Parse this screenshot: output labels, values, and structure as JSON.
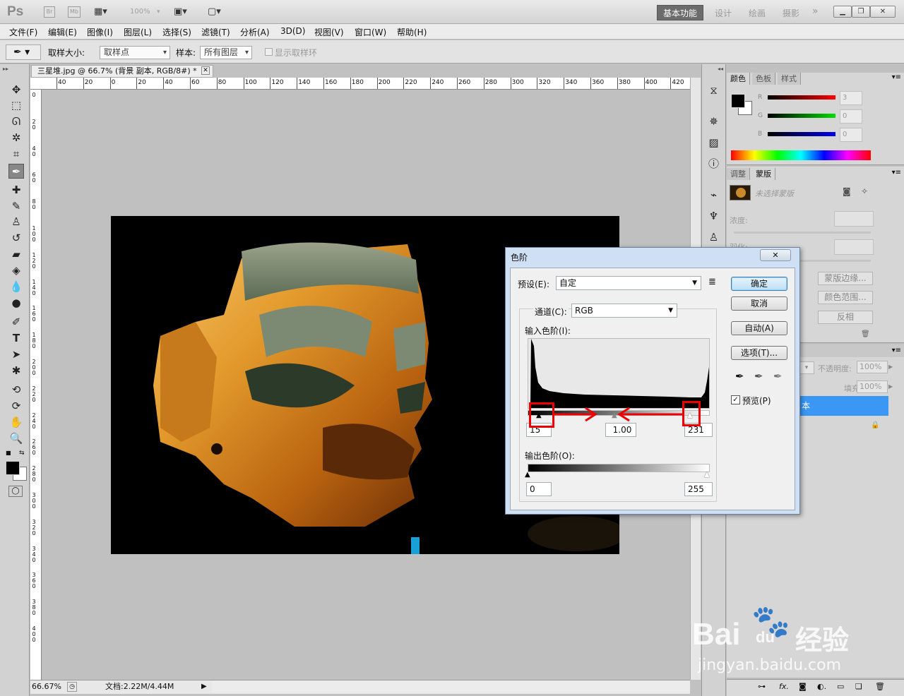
{
  "app": {
    "logo": "Ps",
    "bridge": "Br",
    "minibridge": "Mb",
    "zoom": "100%",
    "workspaces": {
      "active": "基本功能",
      "items": [
        "设计",
        "绘画",
        "摄影"
      ],
      "more": "»"
    }
  },
  "menu": [
    "文件(F)",
    "编辑(E)",
    "图像(I)",
    "图层(L)",
    "选择(S)",
    "滤镜(T)",
    "分析(A)",
    "3D(D)",
    "视图(V)",
    "窗口(W)",
    "帮助(H)"
  ],
  "options": {
    "sample_size_label": "取样大小:",
    "sample_size_value": "取样点",
    "sample_label": "样本:",
    "sample_value": "所有图层",
    "show_ring": "显示取样环"
  },
  "document": {
    "tab_title": "三星堆.jpg @ 66.7% (背景 副本, RGB/8#) *",
    "ruler_top": [
      "40",
      "20",
      "0",
      "20",
      "40",
      "60",
      "80",
      "100",
      "120",
      "140",
      "160",
      "180",
      "200",
      "220",
      "240",
      "260",
      "280",
      "300",
      "320",
      "340",
      "360",
      "380",
      "400",
      "420"
    ],
    "ruler_left": [
      "0",
      "2 0",
      "4 0",
      "6 0",
      "8 0",
      "1 0 0",
      "1 2 0",
      "1 4 0",
      "1 6 0",
      "1 8 0",
      "2 0 0",
      "2 2 0",
      "2 4 0",
      "2 6 0",
      "2 8 0",
      "3 0 0",
      "3 2 0",
      "3 4 0",
      "3 6 0",
      "3 8 0",
      "4 0 0"
    ],
    "status_zoom": "66.67%",
    "status_doc": "文档:2.22M/4.44M"
  },
  "color_panel": {
    "tabs": [
      "颜色",
      "色板",
      "样式"
    ],
    "r_label": "R",
    "g_label": "G",
    "b_label": "B",
    "r": "3",
    "g": "0",
    "b": "0"
  },
  "masks_panel": {
    "tabs": [
      "调整",
      "蒙版"
    ],
    "no_selection": "未选择蒙版",
    "density": "浓度:",
    "feather": "羽化:",
    "mask_edge": "蒙版边缘...",
    "color_range": "颜色范围...",
    "invert": "反相"
  },
  "layers_panel": {
    "opacity_label": "不透明度:",
    "opacity": "100%",
    "fill_label": "填充:",
    "fill": "100%",
    "layer_name_fragment": "本"
  },
  "levels_dialog": {
    "title": "色阶",
    "preset_label": "预设(E):",
    "preset_value": "自定",
    "channel_label": "通道(C):",
    "channel_value": "RGB",
    "input_label": "输入色阶(I):",
    "input_black": "15",
    "input_gamma": "1.00",
    "input_white": "231",
    "output_label": "输出色阶(O):",
    "output_black": "0",
    "output_white": "255",
    "ok": "确定",
    "cancel": "取消",
    "auto": "自动(A)",
    "options": "选项(T)...",
    "preview": "预览(P)"
  },
  "watermark": {
    "brand": "Bai",
    "du": "du",
    "jy": "经验",
    "url": "jingyan.baidu.com"
  }
}
